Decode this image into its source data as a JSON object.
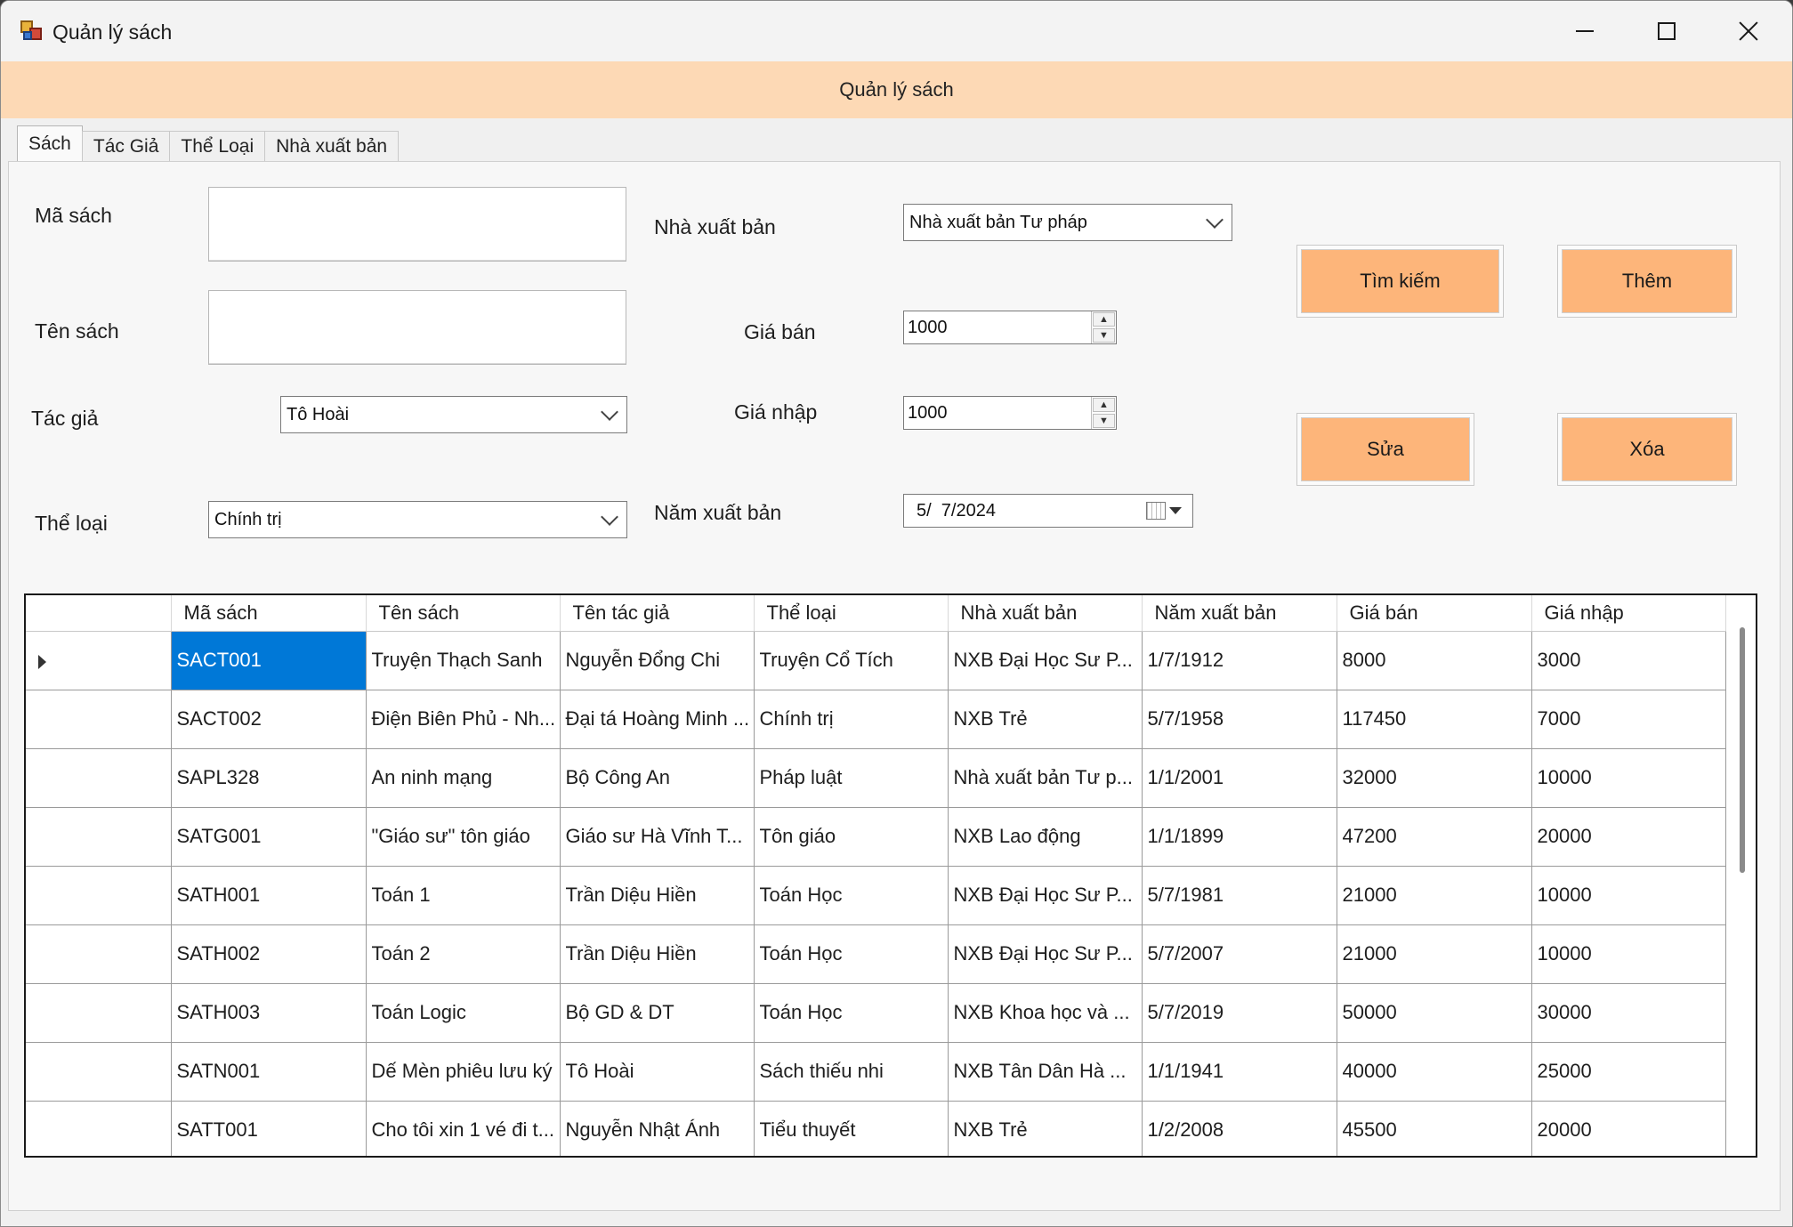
{
  "window": {
    "title": "Quản lý sách"
  },
  "header": {
    "title": "Quản lý sách"
  },
  "tabs": [
    {
      "label": "Sách"
    },
    {
      "label": "Tác Giả"
    },
    {
      "label": "Thể Loại"
    },
    {
      "label": "Nhà xuất bản"
    }
  ],
  "form": {
    "ma_sach_label": "Mã sách",
    "ma_sach_value": "",
    "ten_sach_label": "Tên sách",
    "ten_sach_value": "",
    "tac_gia_label": "Tác giả",
    "tac_gia_value": "Tô Hoài",
    "the_loai_label": "Thể loại",
    "the_loai_value": "Chính trị",
    "nxb_label": "Nhà xuất bản",
    "nxb_value": "Nhà xuất bản Tư pháp",
    "gia_ban_label": "Giá bán",
    "gia_ban_value": "1000",
    "gia_nhap_label": "Giá nhập",
    "gia_nhap_value": "1000",
    "nam_xb_label": "Năm xuất bản",
    "nam_xb_value": "5/  7/2024"
  },
  "buttons": {
    "search": "Tìm kiếm",
    "add": "Thêm",
    "edit": "Sửa",
    "delete": "Xóa"
  },
  "colors": {
    "banner": "#fdd9b5",
    "button": "#fdb57a",
    "selection": "#0078d7"
  },
  "grid": {
    "columns": [
      "Mã sách",
      "Tên sách",
      "Tên tác giả",
      "Thể loại",
      "Nhà xuất bản",
      "Năm xuất bản",
      "Giá bán",
      "Giá nhập"
    ],
    "rows": [
      [
        "SACT001",
        "Truyện Thạch Sanh",
        "Nguyễn Đổng Chi",
        "Truyện Cổ Tích",
        "NXB Đại Học Sư P...",
        "1/7/1912",
        "8000",
        "3000"
      ],
      [
        "SACT002",
        "Điện Biên Phủ - Nh...",
        "Đại tá Hoàng Minh ...",
        "Chính trị",
        "NXB Trẻ",
        "5/7/1958",
        "117450",
        "7000"
      ],
      [
        "SAPL328",
        "An ninh mạng",
        "Bộ Công An",
        "Pháp luật",
        "Nhà xuất bản Tư p...",
        "1/1/2001",
        "32000",
        "10000"
      ],
      [
        "SATG001",
        "\"Giáo sư\" tôn giáo",
        "Giáo sư Hà Vĩnh T...",
        "Tôn giáo",
        "NXB Lao động",
        "1/1/1899",
        "47200",
        "20000"
      ],
      [
        "SATH001",
        "Toán 1",
        "Trần Diệu Hiền",
        "Toán Học",
        "NXB Đại Học Sư P...",
        "5/7/1981",
        "21000",
        "10000"
      ],
      [
        "SATH002",
        "Toán 2",
        "Trần Diệu Hiền",
        "Toán Học",
        "NXB Đại Học Sư P...",
        "5/7/2007",
        "21000",
        "10000"
      ],
      [
        "SATH003",
        "Toán Logic",
        "Bộ GD & DT",
        "Toán Học",
        "NXB Khoa học và ...",
        "5/7/2019",
        "50000",
        "30000"
      ],
      [
        "SATN001",
        "Dế Mèn phiêu lưu ký",
        "Tô Hoài",
        "Sách thiếu nhi",
        "NXB Tân Dân Hà ...",
        "1/1/1941",
        "40000",
        "25000"
      ],
      [
        "SATT001",
        "Cho tôi xin 1 vé đi t...",
        "Nguyễn Nhật Ánh",
        "Tiểu thuyết",
        "NXB Trẻ",
        "1/2/2008",
        "45500",
        "20000"
      ]
    ]
  }
}
